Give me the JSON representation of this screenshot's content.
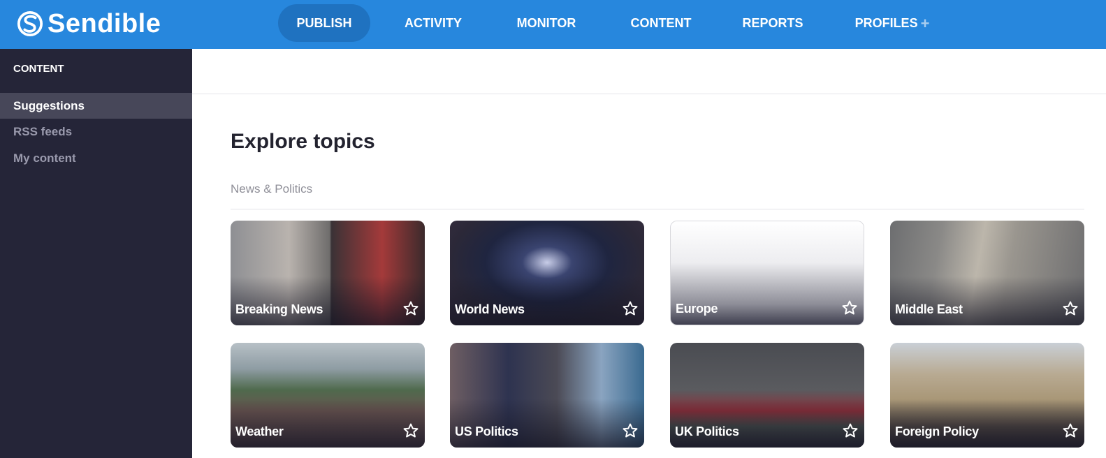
{
  "app": {
    "brand": "Sendible"
  },
  "nav": {
    "items": [
      {
        "label": "PUBLISH",
        "active": true
      },
      {
        "label": "ACTIVITY",
        "active": false
      },
      {
        "label": "MONITOR",
        "active": false
      },
      {
        "label": "CONTENT",
        "active": false
      },
      {
        "label": "REPORTS",
        "active": false
      },
      {
        "label": "PROFILES",
        "active": false
      }
    ],
    "profiles_plus_icon": "plus-icon"
  },
  "sidebar": {
    "title": "CONTENT",
    "items": [
      {
        "label": "Suggestions",
        "active": true
      },
      {
        "label": "RSS feeds",
        "active": false
      },
      {
        "label": "My content",
        "active": false
      }
    ]
  },
  "main": {
    "title": "Explore topics",
    "section": "News & Politics",
    "topics": [
      {
        "label": "Breaking News",
        "icon": "star-outline-icon"
      },
      {
        "label": "World News",
        "icon": "star-outline-icon"
      },
      {
        "label": "Europe",
        "icon": "star-outline-icon"
      },
      {
        "label": "Middle East",
        "icon": "star-outline-icon"
      },
      {
        "label": "Weather",
        "icon": "star-outline-icon"
      },
      {
        "label": "US Politics",
        "icon": "star-outline-icon"
      },
      {
        "label": "UK Politics",
        "icon": "star-outline-icon"
      },
      {
        "label": "Foreign Policy",
        "icon": "star-outline-icon"
      }
    ]
  },
  "colors": {
    "topbar": "#2787dd",
    "nav_active": "#1f72c0",
    "sidebar": "#252538",
    "sidebar_active": "#474759"
  }
}
